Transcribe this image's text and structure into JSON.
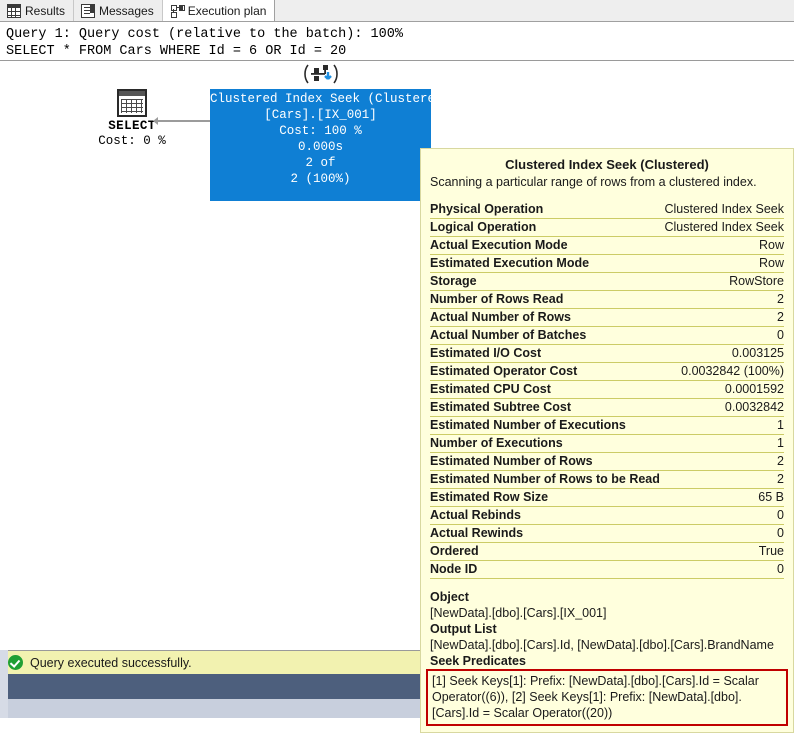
{
  "tabs": [
    {
      "label": "Results",
      "icon": "grid-icon",
      "active": false
    },
    {
      "label": "Messages",
      "icon": "document-icon",
      "active": false
    },
    {
      "label": "Execution plan",
      "icon": "execution-plan-icon",
      "active": true
    }
  ],
  "query_header": {
    "line1": "Query 1: Query cost (relative to the batch): 100%",
    "line2": "SELECT * FROM Cars WHERE Id = 6 OR Id = 20"
  },
  "plan": {
    "select_node": {
      "label": "SELECT",
      "cost": "Cost: 0 %",
      "icon": "select-result-icon"
    },
    "seek_node": {
      "icon": "clustered-index-seek-icon",
      "line1": "Clustered Index Seek (Clustered)",
      "line2": "[Cars].[IX_001]",
      "line3": "Cost: 100 %",
      "line4": "0.000s",
      "line5": "2 of",
      "line6": "2 (100%)",
      "color": "#0f7fd4"
    }
  },
  "tooltip": {
    "title": "Clustered Index Seek (Clustered)",
    "description": "Scanning a particular range of rows from a clustered index.",
    "rows": [
      {
        "key": "Physical Operation",
        "value": "Clustered Index Seek"
      },
      {
        "key": "Logical Operation",
        "value": "Clustered Index Seek"
      },
      {
        "key": "Actual Execution Mode",
        "value": "Row"
      },
      {
        "key": "Estimated Execution Mode",
        "value": "Row"
      },
      {
        "key": "Storage",
        "value": "RowStore"
      },
      {
        "key": "Number of Rows Read",
        "value": "2"
      },
      {
        "key": "Actual Number of Rows",
        "value": "2"
      },
      {
        "key": "Actual Number of Batches",
        "value": "0"
      },
      {
        "key": "Estimated I/O Cost",
        "value": "0.003125"
      },
      {
        "key": "Estimated Operator Cost",
        "value": "0.0032842 (100%)"
      },
      {
        "key": "Estimated CPU Cost",
        "value": "0.0001592"
      },
      {
        "key": "Estimated Subtree Cost",
        "value": "0.0032842"
      },
      {
        "key": "Estimated Number of Executions",
        "value": "1"
      },
      {
        "key": "Number of Executions",
        "value": "1"
      },
      {
        "key": "Estimated Number of Rows",
        "value": "2"
      },
      {
        "key": "Estimated Number of Rows to be Read",
        "value": "2"
      },
      {
        "key": "Estimated Row Size",
        "value": "65 B"
      },
      {
        "key": "Actual Rebinds",
        "value": "0"
      },
      {
        "key": "Actual Rewinds",
        "value": "0"
      },
      {
        "key": "Ordered",
        "value": "True"
      },
      {
        "key": "Node ID",
        "value": "0"
      }
    ],
    "object_head": "Object",
    "object_value": "[NewData].[dbo].[Cars].[IX_001]",
    "output_head": "Output List",
    "output_value": "[NewData].[dbo].[Cars].Id, [NewData].[dbo].[Cars].BrandName",
    "seek_head": "Seek Predicates",
    "seek_value": "[1] Seek Keys[1]: Prefix: [NewData].[dbo].[Cars].Id = Scalar Operator((6)), [2] Seek Keys[1]: Prefix: [NewData].[dbo].[Cars].Id = Scalar Operator((20))",
    "highlight_color": "#c00000",
    "background": "#ffffdd"
  },
  "status": {
    "message": "Query executed successfully.",
    "icon": "success-check-icon",
    "background": "#f2f2b0"
  }
}
